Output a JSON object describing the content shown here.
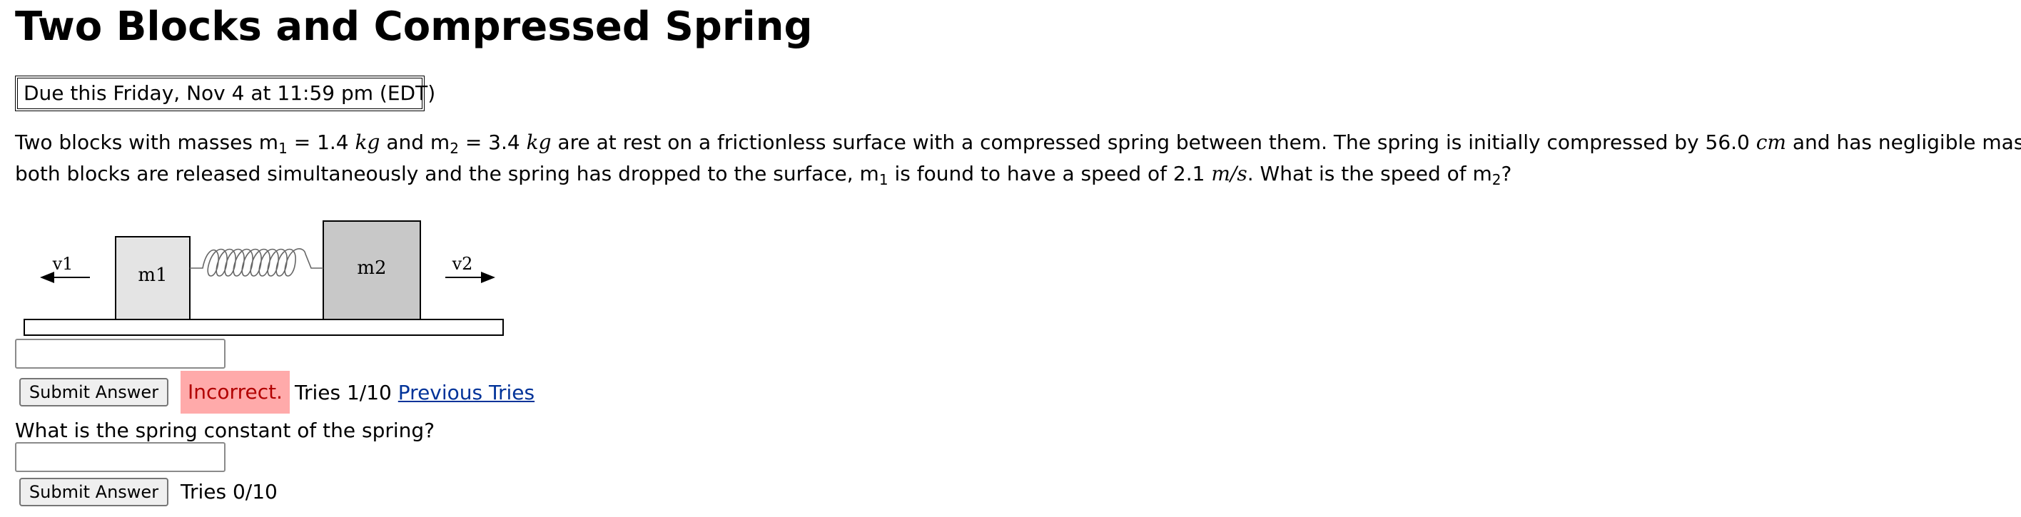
{
  "page": {
    "title": "Two Blocks and Compressed Spring",
    "due": "Due this Friday, Nov 4 at 11:59 pm (EDT)"
  },
  "problem": {
    "t1": "Two blocks with masses m",
    "sub1": "1",
    "t2": " = 1.4 ",
    "unit_kg_1": "kg",
    "t3": " and m",
    "sub2": "2",
    "t4": " = 3.4 ",
    "unit_kg_2": "kg",
    "t5": " are at rest on a frictionless surface with a compressed spring between them. The spring is initially compressed by 56.0 ",
    "unit_cm": "cm",
    "t6": " and has negligible mass. When",
    "t7": "both blocks are released simultaneously and the spring has dropped to the surface, m",
    "sub3": "1",
    "t8": " is found to have a speed of 2.1 ",
    "unit_ms": "m/s",
    "t9": ". What is the speed of m",
    "sub4": "2",
    "t10": "?"
  },
  "diagram": {
    "v1": "v1",
    "m1": "m1",
    "m2": "m2",
    "v2": "v2"
  },
  "part1": {
    "input_value": "",
    "submit_label": "Submit Answer",
    "status": "Incorrect.",
    "tries": "Tries 1/10",
    "previous_tries": "Previous Tries"
  },
  "part2": {
    "question": "What is the spring constant of the spring?",
    "input_value": "",
    "submit_label": "Submit Answer",
    "tries": "Tries 0/10"
  },
  "colors": {
    "incorrect_bg": "#ffaaaa",
    "incorrect_text": "#b20000",
    "link": "#003399",
    "block_m1": "#e4e4e4",
    "block_m2": "#c8c8c8"
  }
}
